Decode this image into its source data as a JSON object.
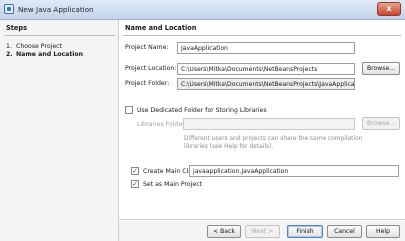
{
  "window": {
    "title": "New Java Application",
    "close_glyph": "x",
    "icon": "netbeans-app-icon"
  },
  "steps": {
    "heading": "Steps",
    "items": [
      {
        "num": "1.",
        "label": "Choose Project",
        "active": false
      },
      {
        "num": "2.",
        "label": "Name and Location",
        "active": true
      }
    ]
  },
  "main": {
    "heading": "Name and Location",
    "project_name_label": "Project Name:",
    "project_name_value": "JavaApplication",
    "project_location_label": "Project Location:",
    "project_location_value": "C:\\Users\\Mitka\\Documents\\NetBeansProjects",
    "browse_label": "Browse...",
    "project_folder_label": "Project Folder:",
    "project_folder_value": "C:\\Users\\Mitka\\Documents\\NetBeansProjects\\JavaApplication",
    "dedicated_folder_label": "Use Dedicated Folder for Storing Libraries",
    "dedicated_folder_checked": false,
    "libraries_folder_label": "Libraries Folder:",
    "libraries_folder_value": "",
    "libraries_browse_label": "Browse...",
    "libraries_help": "Different users and projects can share the same compilation libraries (see Help for details).",
    "create_main_class_label": "Create Main Class",
    "create_main_class_checked": true,
    "main_class_value": "javaapplication.JavaApplication",
    "set_main_project_label": "Set as Main Project",
    "set_main_project_checked": true
  },
  "buttons": {
    "back": "< Back",
    "next": "Next >",
    "finish": "Finish",
    "cancel": "Cancel",
    "help": "Help"
  }
}
